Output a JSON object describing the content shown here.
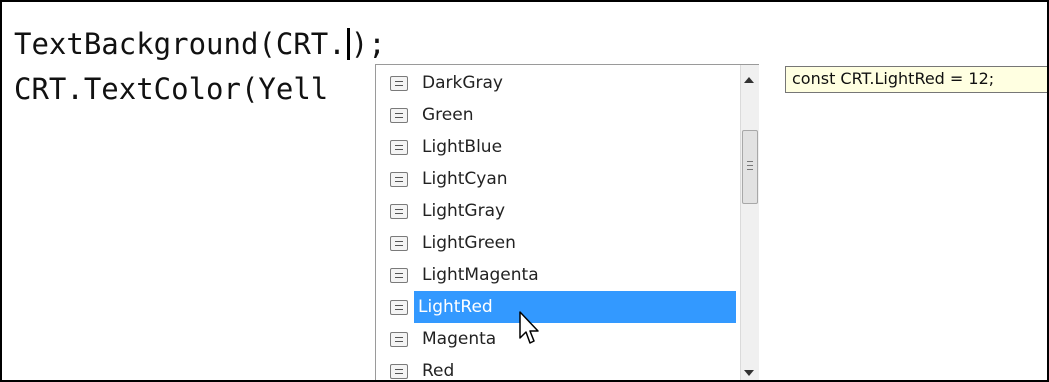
{
  "editor": {
    "line1_before_caret": "TextBackground(CRT.",
    "line1_after_caret": ");",
    "line2": "CRT.TextColor(Yell"
  },
  "completion": {
    "items": [
      {
        "label": "DarkGray",
        "icon": "constant-icon"
      },
      {
        "label": "Green",
        "icon": "constant-icon"
      },
      {
        "label": "LightBlue",
        "icon": "constant-icon"
      },
      {
        "label": "LightCyan",
        "icon": "constant-icon"
      },
      {
        "label": "LightGray",
        "icon": "constant-icon"
      },
      {
        "label": "LightGreen",
        "icon": "constant-icon"
      },
      {
        "label": "LightMagenta",
        "icon": "constant-icon"
      },
      {
        "label": "LightRed",
        "icon": "constant-icon",
        "selected": true
      },
      {
        "label": "Magenta",
        "icon": "constant-icon"
      },
      {
        "label": "Red",
        "icon": "constant-icon"
      }
    ],
    "selection_color": "#3399ff"
  },
  "tooltip": {
    "text": "const CRT.LightRed = 12;"
  }
}
